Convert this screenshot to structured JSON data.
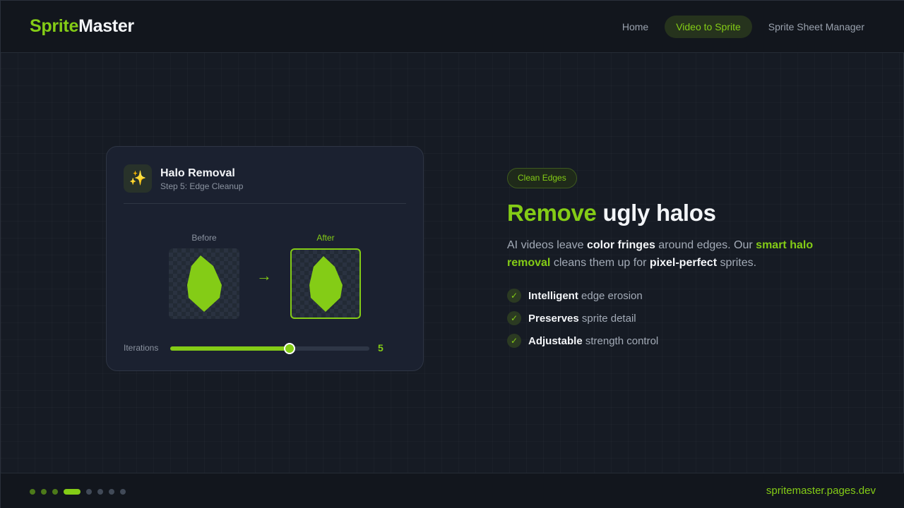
{
  "header": {
    "logo": {
      "part1": "Sprite",
      "part2": "Master"
    },
    "nav": [
      {
        "label": "Home",
        "active": false
      },
      {
        "label": "Video to Sprite",
        "active": true
      },
      {
        "label": "Sprite Sheet Manager",
        "active": false
      }
    ]
  },
  "card": {
    "icon": "sparkles-icon",
    "title": "Halo Removal",
    "subtitle": "Step 5: Edge Cleanup",
    "before_label": "Before",
    "after_label": "After",
    "arrow": "→",
    "slider": {
      "label": "Iterations",
      "value": "5",
      "fraction": 0.6
    }
  },
  "hero": {
    "pill": "Clean Edges",
    "headline_accent": "Remove",
    "headline_rest": "ugly halos",
    "desc": {
      "t1": "AI videos leave ",
      "b1": "color fringes",
      "t2": " around edges. Our ",
      "g1": "smart halo removal",
      "t3": " cleans them up for ",
      "b2": "pixel-perfect",
      "t4": " sprites."
    },
    "features": [
      {
        "bold": "Intelligent",
        "text": " edge erosion"
      },
      {
        "bold": "Preserves",
        "text": " sprite detail"
      },
      {
        "bold": "Adjustable",
        "text": " strength control"
      }
    ]
  },
  "footer": {
    "url": "spritemaster.pages.dev",
    "progress": {
      "total": 8,
      "current": 4
    }
  },
  "colors": {
    "accent": "#84cc16",
    "background": "#161b24",
    "card": "#1b2130"
  }
}
